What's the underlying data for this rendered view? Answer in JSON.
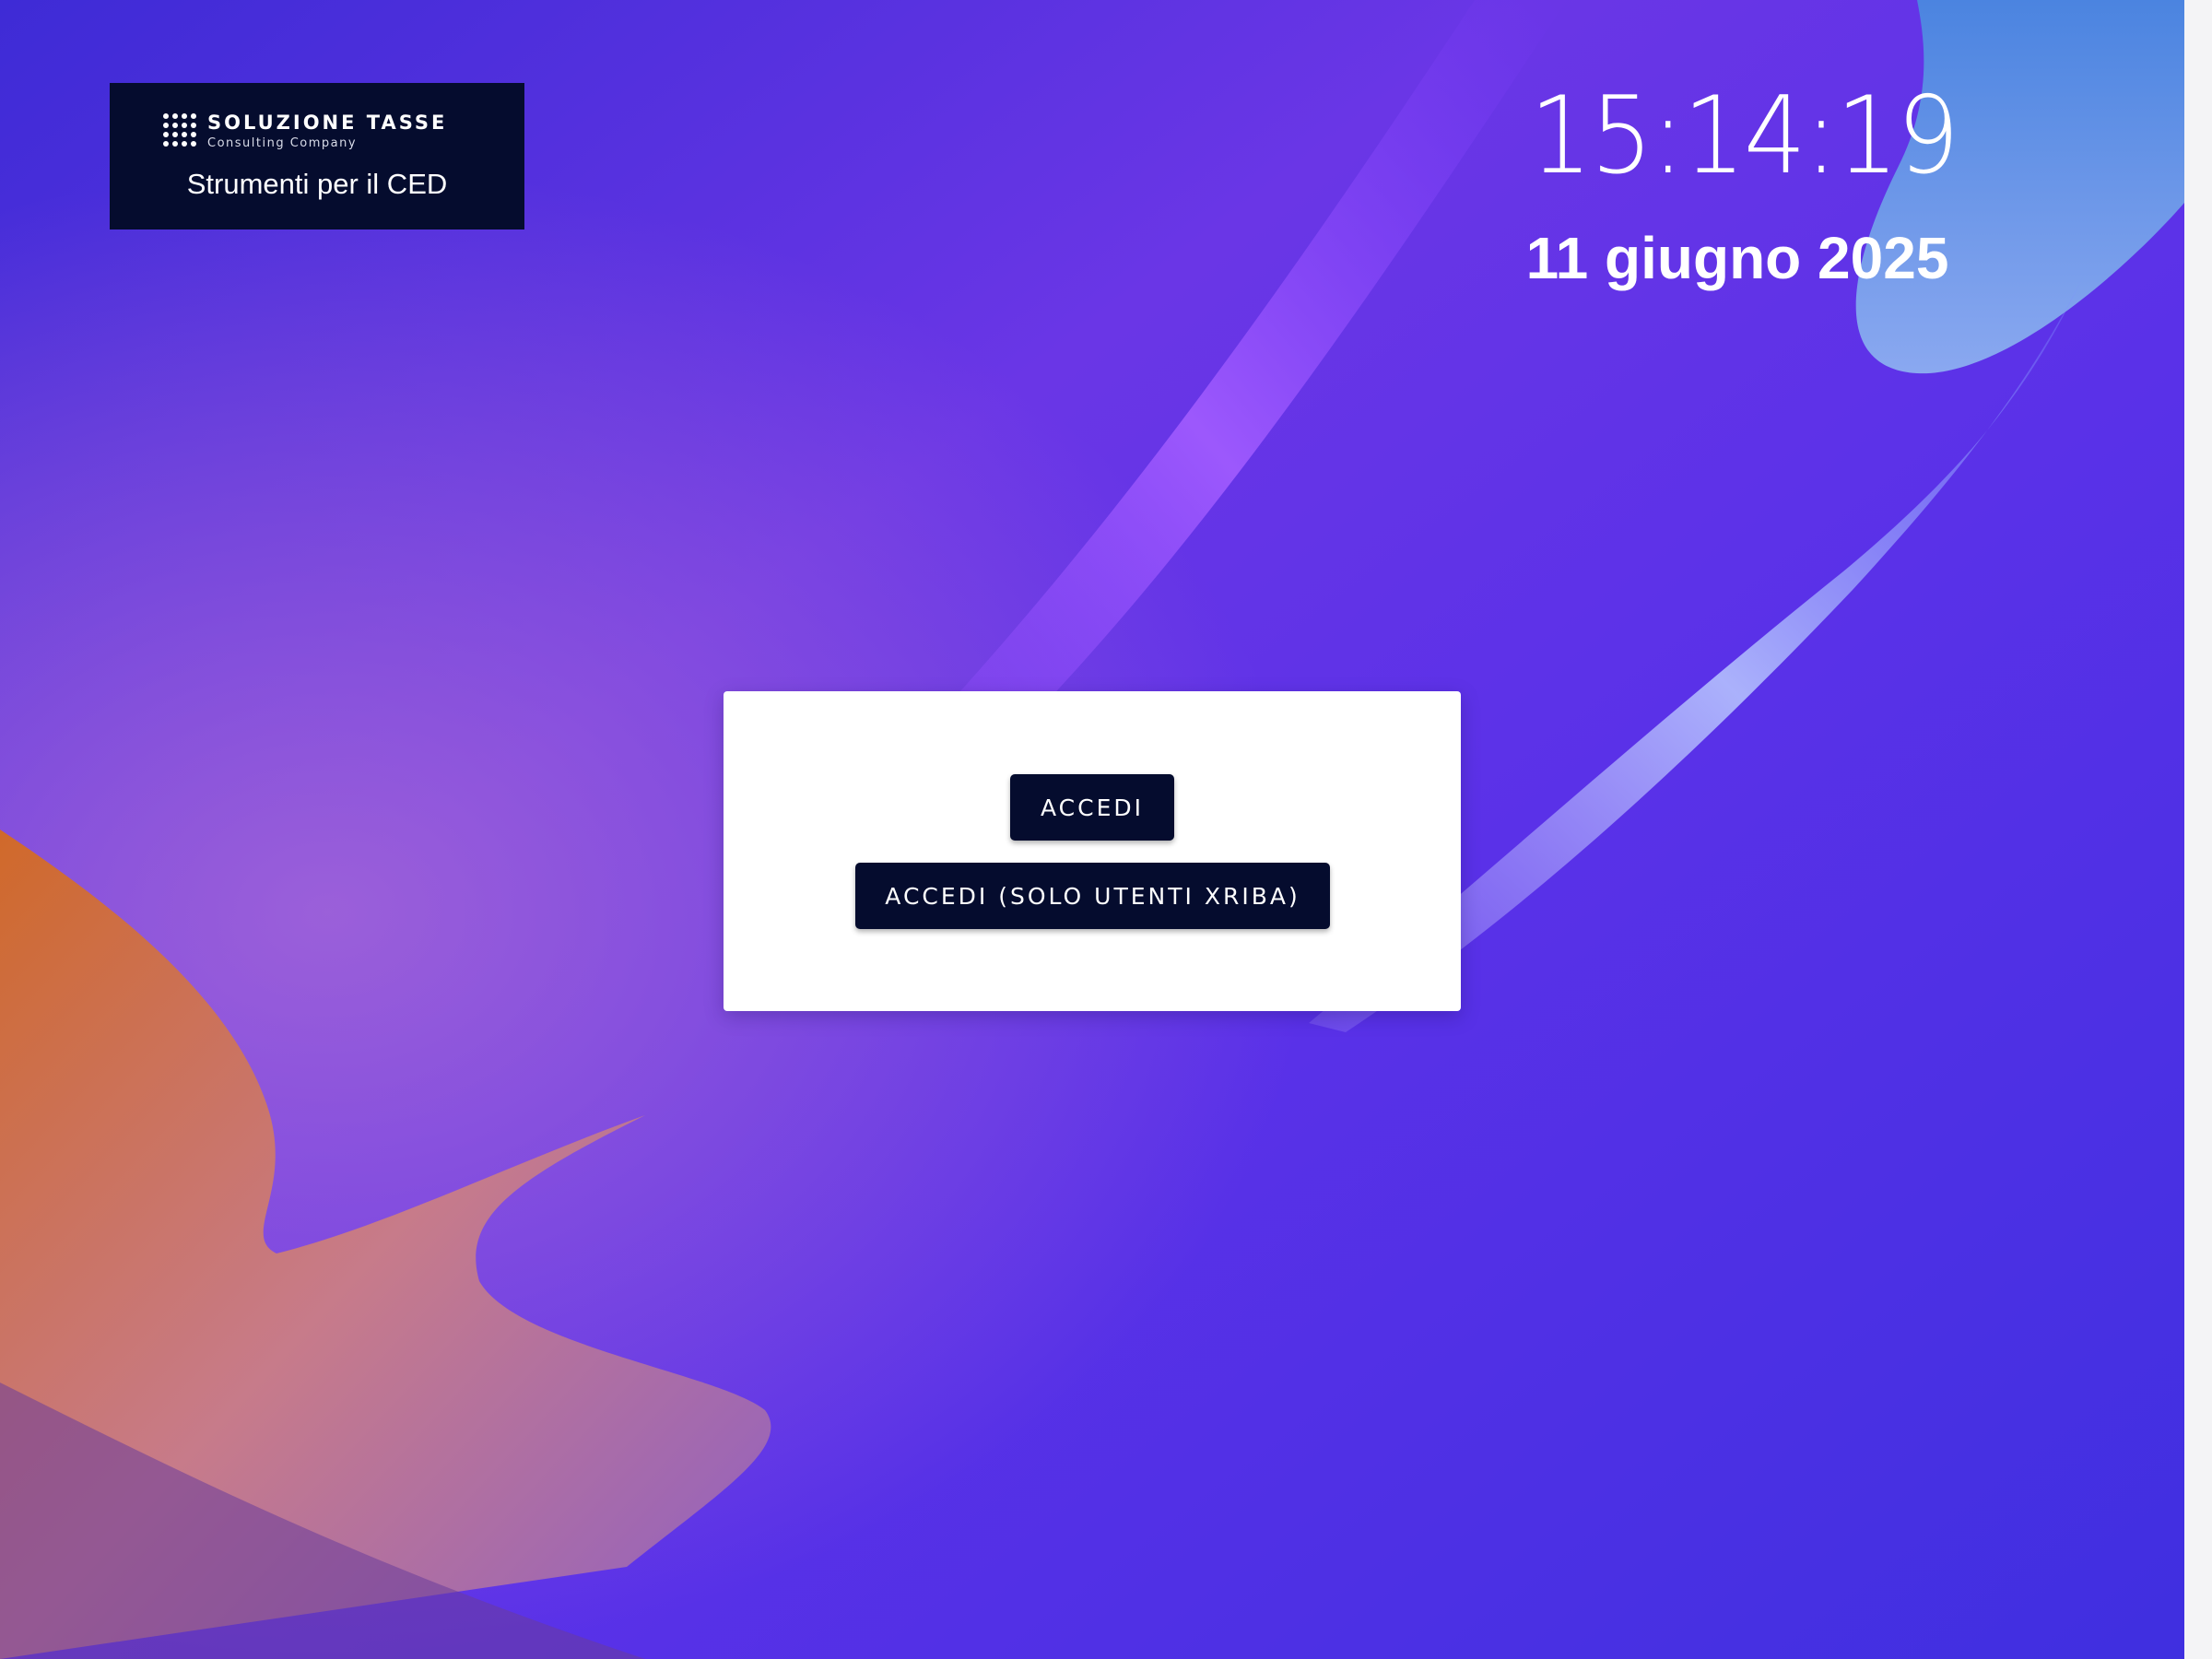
{
  "brand": {
    "name": "SOLUZIONE TASSE",
    "tagline": "Consulting Company",
    "caption": "Strumenti per il CED"
  },
  "clock": {
    "time": "15:14:19",
    "date": "11 giugno 2025"
  },
  "login": {
    "accedi_label": "ACCEDI",
    "accedi_xriba_label": "ACCEDI (SOLO UTENTI XRIBA)"
  },
  "colors": {
    "brand_navy": "#050c2e",
    "wallpaper_violet": "#5a2fe0",
    "wallpaper_orange": "#d86a2a",
    "card_background": "#ffffff"
  }
}
